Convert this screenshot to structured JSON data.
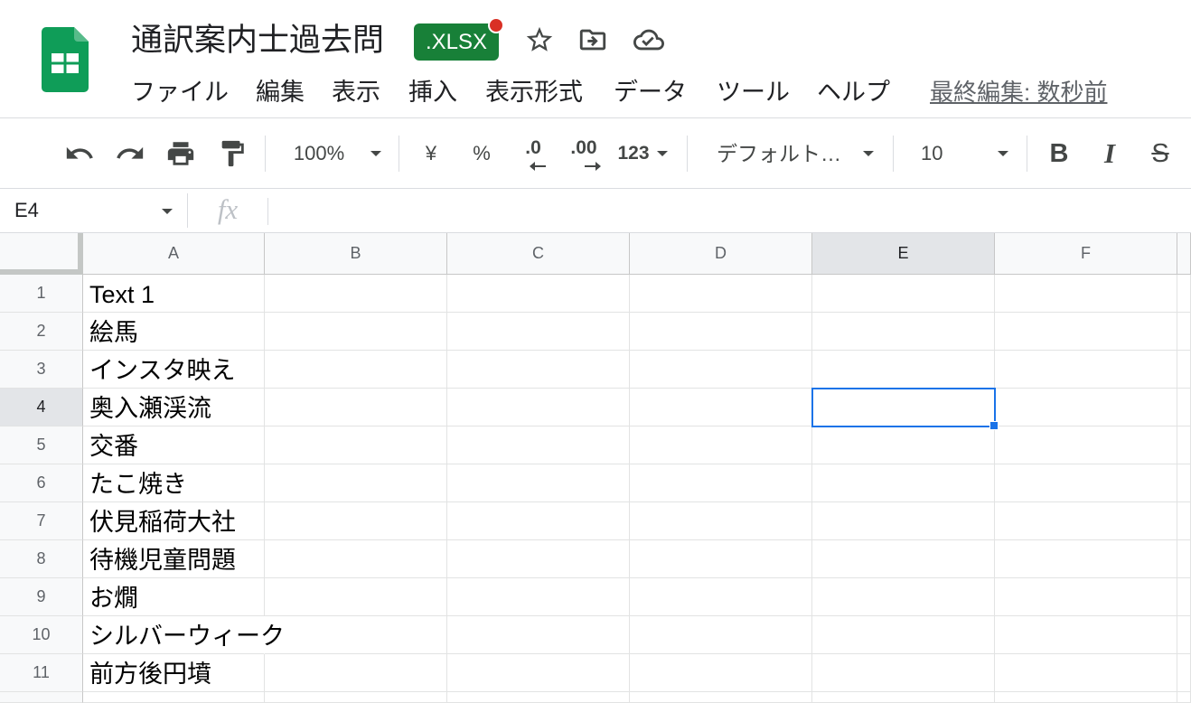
{
  "colors": {
    "sheets_green": "#0f9d58",
    "file_badge_green": "#188038",
    "notification_red": "#d93025",
    "selection_blue": "#1a73e8",
    "header_background": "#f8f9fa",
    "header_selected_background": "#e3e5e8",
    "gridline": "#e2e3e3"
  },
  "header": {
    "logo_icon": "google-sheets-logo-icon",
    "title": "通訳案内士過去問",
    "file_badge": ".XLSX",
    "icons": [
      "star-icon",
      "move-to-folder-icon",
      "cloud-saved-icon"
    ],
    "menu": [
      "ファイル",
      "編集",
      "表示",
      "挿入",
      "表示形式",
      "データ",
      "ツール",
      "ヘルプ"
    ],
    "last_edit": "最終編集: 数秒前"
  },
  "toolbar": {
    "icons": [
      "undo-icon",
      "redo-icon",
      "print-icon",
      "paint-format-icon"
    ],
    "zoom": "100%",
    "currency": "¥",
    "percent": "%",
    "decrease_decimal": ".0",
    "increase_decimal": ".00",
    "more_formats": "123",
    "font_dropdown": "デフォルト…",
    "font_size": "10",
    "bold": "B",
    "italic": "I",
    "strikethrough": "S"
  },
  "formula_bar": {
    "name_box": "E4",
    "fx_label": "fx"
  },
  "sheet": {
    "columns": [
      "A",
      "B",
      "C",
      "D",
      "E",
      "F"
    ],
    "selected_cell": "E4",
    "rows": [
      {
        "row": "1",
        "A": "Text 1"
      },
      {
        "row": "2",
        "A": "絵馬"
      },
      {
        "row": "3",
        "A": "インスタ映え"
      },
      {
        "row": "4",
        "A": "奥入瀬渓流"
      },
      {
        "row": "5",
        "A": "交番"
      },
      {
        "row": "6",
        "A": "たこ焼き"
      },
      {
        "row": "7",
        "A": "伏見稲荷大社"
      },
      {
        "row": "8",
        "A": "待機児童問題"
      },
      {
        "row": "9",
        "A": "お燗"
      },
      {
        "row": "10",
        "A": "シルバーウィーク"
      },
      {
        "row": "11",
        "A": "前方後円墳"
      }
    ]
  }
}
